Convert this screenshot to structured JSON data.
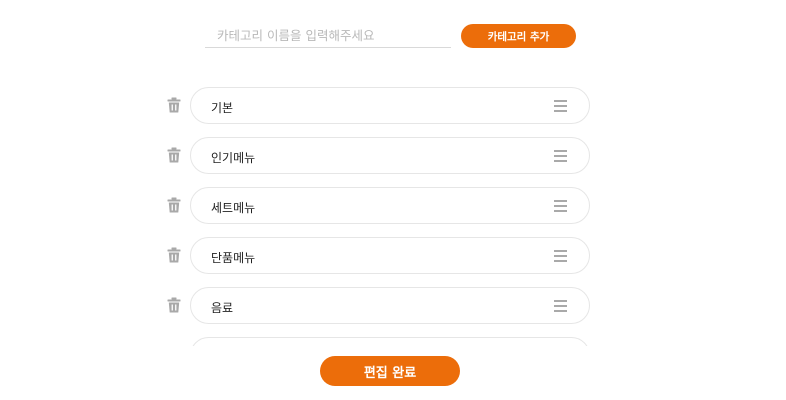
{
  "add_category": {
    "placeholder": "카테고리 이름을 입력해주세요",
    "button_label": "카테고리 추가"
  },
  "categories": [
    {
      "label": "기본"
    },
    {
      "label": "인기메뉴"
    },
    {
      "label": "세트메뉴"
    },
    {
      "label": "단품메뉴"
    },
    {
      "label": "음료"
    },
    {
      "label": ""
    }
  ],
  "footer": {
    "done_label": "편집 완료"
  },
  "colors": {
    "accent": "#ec6d0a",
    "icon": "#a9a9a9",
    "border": "#e6e6e6"
  },
  "icons": {
    "delete": "trash-icon",
    "reorder": "drag-handle-icon"
  }
}
